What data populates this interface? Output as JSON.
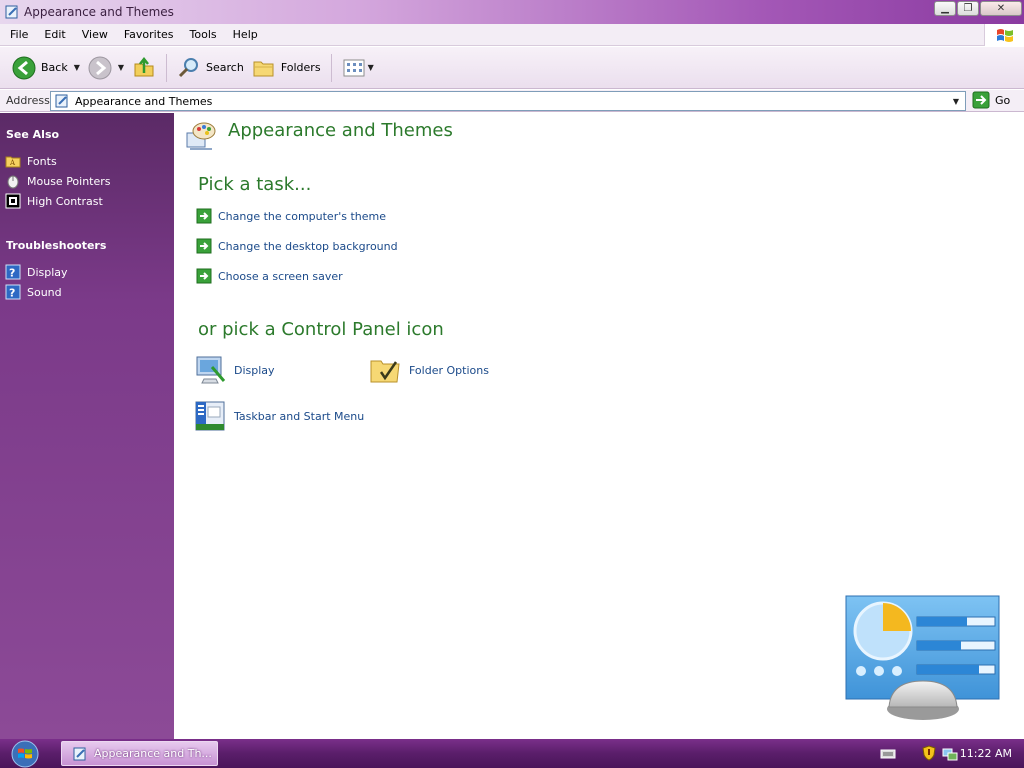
{
  "window": {
    "title": "Appearance and Themes"
  },
  "menu": {
    "items": [
      "File",
      "Edit",
      "View",
      "Favorites",
      "Tools",
      "Help"
    ]
  },
  "toolbar": {
    "back_label": "Back",
    "search_label": "Search",
    "folders_label": "Folders"
  },
  "address": {
    "label": "Address",
    "value": "Appearance and Themes",
    "go_label": "Go"
  },
  "sidebar": {
    "see_also_heading": "See Also",
    "see_also": [
      {
        "label": "Fonts",
        "icon": "folder-fonts-icon"
      },
      {
        "label": "Mouse Pointers",
        "icon": "mouse-icon"
      },
      {
        "label": "High Contrast",
        "icon": "high-contrast-icon"
      }
    ],
    "troubleshooters_heading": "Troubleshooters",
    "troubleshooters": [
      {
        "label": "Display",
        "icon": "help-icon"
      },
      {
        "label": "Sound",
        "icon": "help-icon"
      }
    ]
  },
  "main": {
    "title": "Appearance and Themes",
    "pick_task_heading": "Pick a task...",
    "tasks": [
      {
        "label": "Change the computer's theme"
      },
      {
        "label": "Change the desktop background"
      },
      {
        "label": "Choose a screen saver"
      }
    ],
    "pick_icon_heading": "or pick a Control Panel icon",
    "icons": [
      {
        "label": "Display",
        "icon": "display-icon"
      },
      {
        "label": "Folder Options",
        "icon": "folder-options-icon"
      },
      {
        "label": "Taskbar and Start Menu",
        "icon": "taskbar-icon"
      }
    ]
  },
  "taskbar": {
    "active_window": "Appearance and Th...",
    "clock": "11:22 AM"
  },
  "colors": {
    "heading_green": "#2c7a2c",
    "link_blue": "#1b4a8a",
    "sidebar_purple": "#7b3a89"
  }
}
